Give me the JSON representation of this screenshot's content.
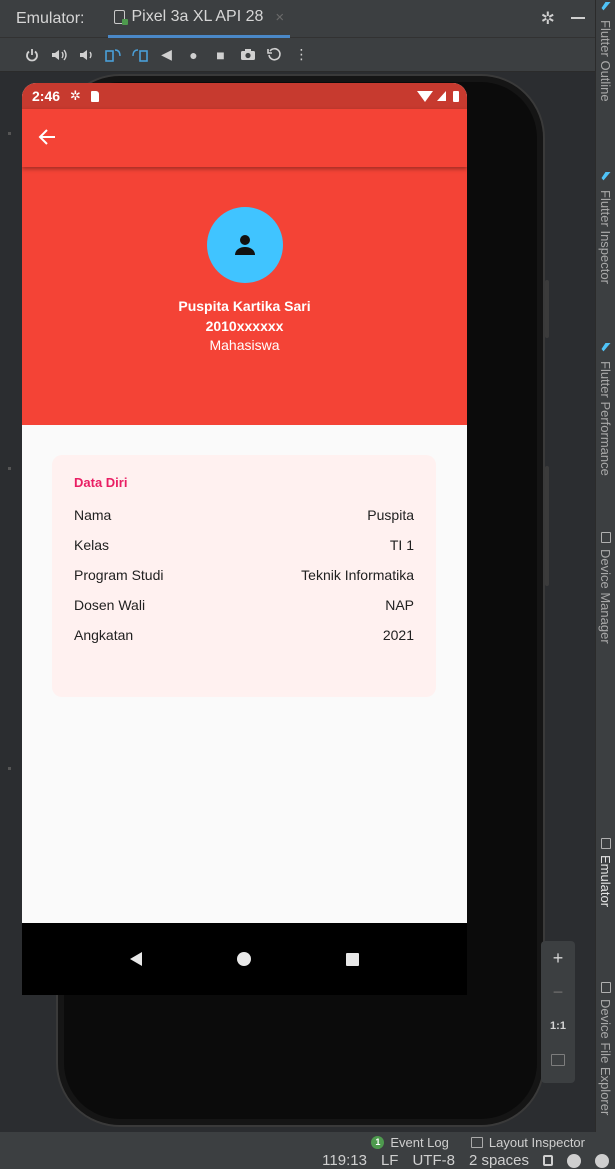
{
  "ide": {
    "title_label": "Emulator:",
    "device_tab": "Pixel 3a XL API 28",
    "tab_close": "×",
    "right_tools": [
      "Flutter Outline",
      "Flutter Inspector",
      "Flutter Performance",
      "Device Manager",
      "Emulator",
      "Device File Explorer"
    ],
    "zoom": {
      "plus": "+",
      "minus": "−",
      "one_to_one": "1:1"
    },
    "event_bar": {
      "event_count": "1",
      "event_log": "Event Log",
      "layout_inspector": "Layout Inspector"
    },
    "status_bar": {
      "position": "119:13",
      "line_sep": "LF",
      "encoding": "UTF-8",
      "indent": "2 spaces"
    }
  },
  "phone": {
    "status_bar": {
      "time": "2:46"
    },
    "appbar": {
      "back_icon": "arrow-back-icon"
    },
    "colors": {
      "primary": "#f44336",
      "status": "#c73a2f",
      "avatar": "#40c4ff",
      "accent": "#e91e63",
      "card": "#fff1f0"
    },
    "profile": {
      "name": "Puspita Kartika Sari",
      "nim": "2010xxxxxx",
      "role": "Mahasiswa"
    },
    "card": {
      "title": "Data Diri",
      "rows": [
        {
          "label": "Nama",
          "value": "Puspita"
        },
        {
          "label": "Kelas",
          "value": "TI 1"
        },
        {
          "label": "Program Studi",
          "value": "Teknik Informatika"
        },
        {
          "label": "Dosen Wali",
          "value": "NAP"
        },
        {
          "label": "Angkatan",
          "value": "2021"
        }
      ]
    }
  }
}
